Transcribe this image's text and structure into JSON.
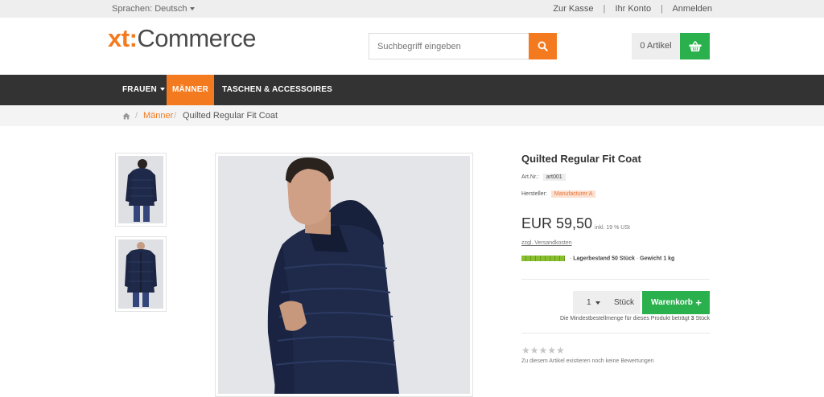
{
  "topbar": {
    "language": "Sprachen: Deutsch",
    "links": [
      "Zur Kasse",
      "Ihr Konto",
      "Anmelden"
    ],
    "separator": "|"
  },
  "header": {
    "logo_prefix": "xt:",
    "logo_suffix": "Commerce",
    "search_placeholder": "Suchbegriff eingeben",
    "search_icon": "search-icon",
    "cart_count": "0 Artikel",
    "cart_icon": "basket-icon"
  },
  "nav": {
    "items": [
      "FRAUEN",
      "MÄNNER",
      "TASCHEN & ACCESSOIRES"
    ],
    "active": "MÄNNER"
  },
  "breadcrumb": {
    "home_icon": "home-icon",
    "separator": "/",
    "items": [
      "Männer",
      "Quilted Regular Fit Coat"
    ]
  },
  "product": {
    "title": "Quilted Regular Fit Coat",
    "art_label": "Art.Nr.:",
    "art_value": "art001",
    "manufacturer_label": "Hersteller:",
    "manufacturer_value": "Manufacturer A",
    "price": "EUR 59,50",
    "tax_note": "inkl. 19 % USt",
    "shipping_link": "zzgl. Versandkosten",
    "stock_level": 1.0,
    "stock_text": "Lagerbestand 50 Stück",
    "weight_text": "Gewicht 1 kg",
    "bullet": "·",
    "quantity": "1",
    "unit": "Stück",
    "add_to_cart": "Warenkorb",
    "add_icon": "plus-icon",
    "min_order_prefix": "Die Mindestbestellmenge für dieses Produkt beträgt",
    "min_order_value": "3",
    "min_order_suffix": "Stück",
    "rating_stars": "★★★★★",
    "rating_value": 0,
    "no_reviews": "Zu diesem Artikel existieren noch keine Bewertungen"
  },
  "colors": {
    "accent": "#f47a20",
    "nav_bg": "#333333",
    "cart_green": "#2ab14e"
  }
}
